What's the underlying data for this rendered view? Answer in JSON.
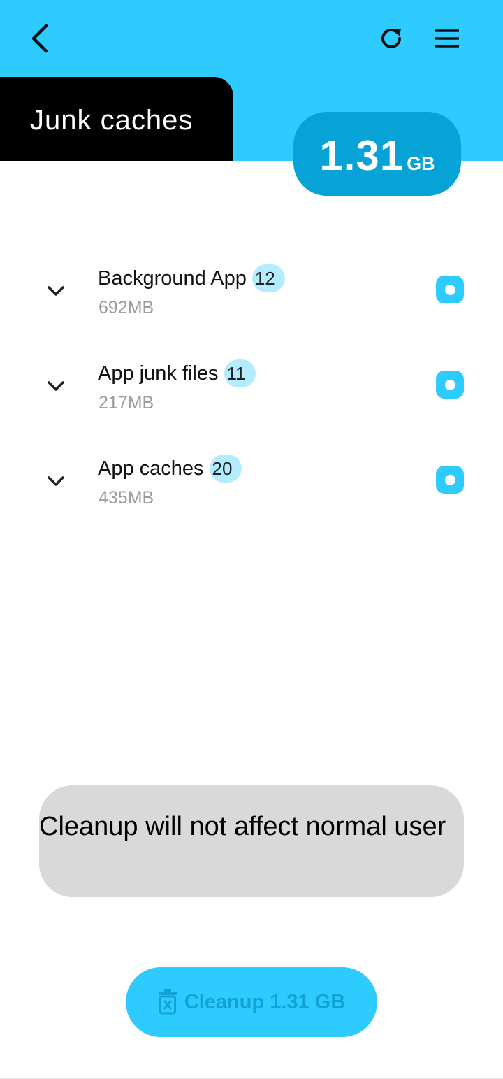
{
  "header": {
    "title": "Junk caches",
    "total_size_value": "1.31",
    "total_size_unit": "GB"
  },
  "colors": {
    "accent": "#2ecbff",
    "accent_dark": "#07a2d6",
    "badge_bg": "#b3ecff",
    "notice_bg": "#d9d9d9"
  },
  "items": [
    {
      "name": "Background App",
      "count": "12",
      "size": "692MB",
      "selected": true
    },
    {
      "name": "App junk files",
      "count": "11",
      "size": "217MB",
      "selected": true
    },
    {
      "name": "App caches",
      "count": "20",
      "size": "435MB",
      "selected": true
    }
  ],
  "notice": {
    "text": "Cleanup will not affect normal user"
  },
  "action": {
    "cleanup_label": "Cleanup 1.31 GB"
  }
}
